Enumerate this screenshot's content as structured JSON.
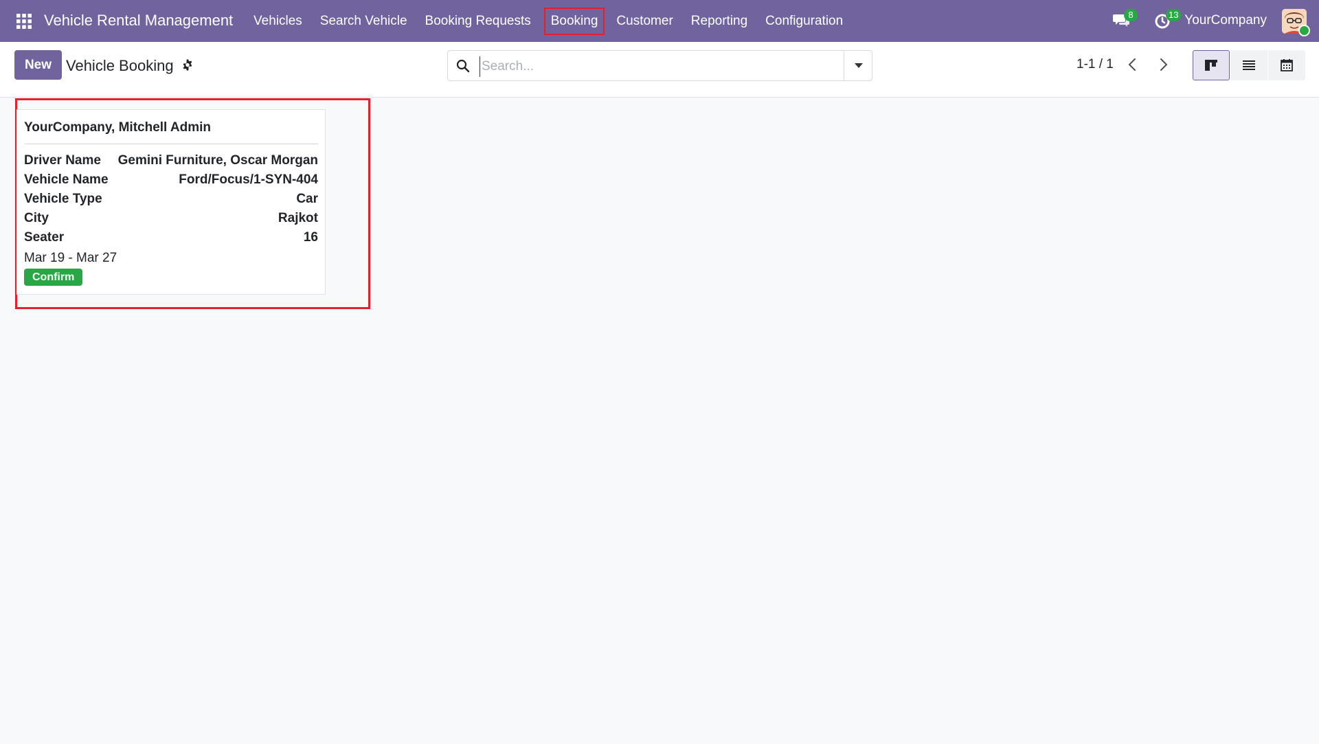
{
  "navbar": {
    "app_title": "Vehicle Rental Management",
    "menu": [
      {
        "label": "Vehicles"
      },
      {
        "label": "Search Vehicle"
      },
      {
        "label": "Booking Requests"
      },
      {
        "label": "Booking"
      },
      {
        "label": "Customer"
      },
      {
        "label": "Reporting"
      },
      {
        "label": "Configuration"
      }
    ],
    "messages_count": "8",
    "activities_count": "13",
    "company": "YourCompany",
    "icons": [
      "apps-grid-icon",
      "chat-icon",
      "clock-icon",
      "user-avatar"
    ]
  },
  "control_panel": {
    "new_label": "New",
    "title": "Vehicle Booking",
    "search_placeholder": "Search...",
    "pager": "1-1 / 1",
    "views": [
      "kanban-view-icon",
      "list-view-icon",
      "calendar-view-icon"
    ]
  },
  "card": {
    "title": "YourCompany, Mitchell Admin",
    "fields": [
      {
        "label": "Driver Name",
        "value": "Gemini Furniture, Oscar Morgan"
      },
      {
        "label": "Vehicle Name",
        "value": "Ford/Focus/1-SYN-404"
      },
      {
        "label": "Vehicle Type",
        "value": "Car"
      },
      {
        "label": "City",
        "value": "Rajkot"
      },
      {
        "label": "Seater",
        "value": "16"
      }
    ],
    "dates": "Mar 19 - Mar 27",
    "status": "Confirm"
  },
  "colors": {
    "brand": "#71639e",
    "highlight": "#e5202b",
    "success": "#28a745"
  }
}
